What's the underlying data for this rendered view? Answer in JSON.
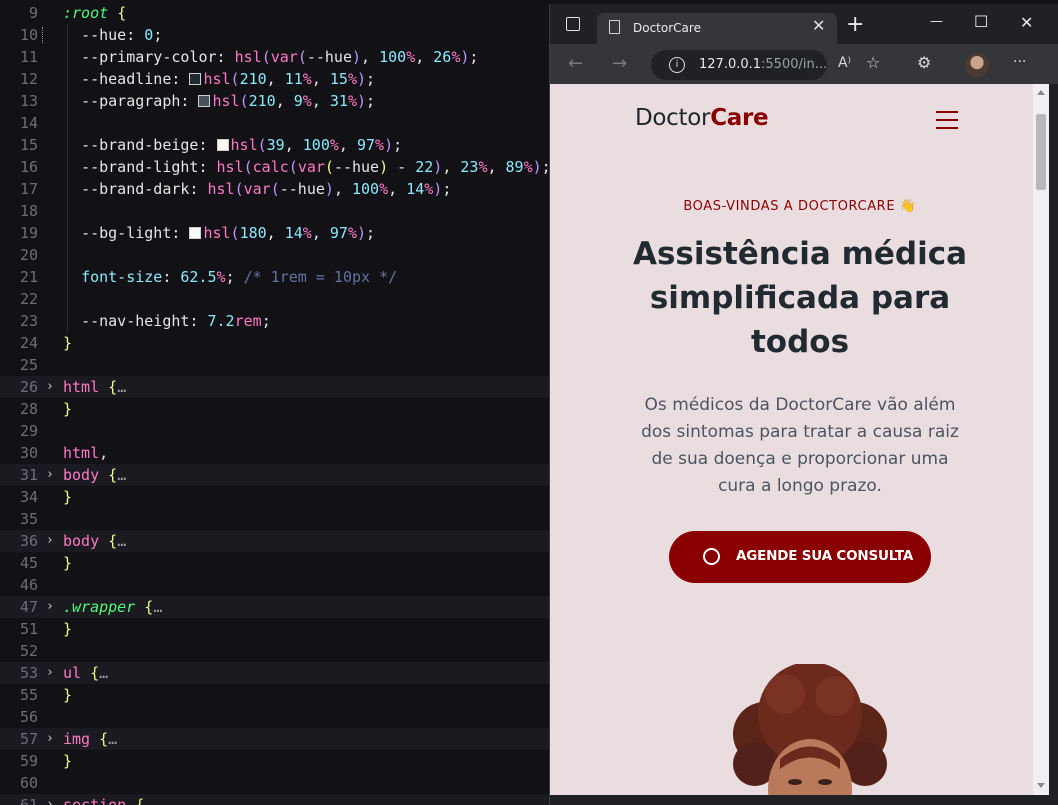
{
  "editor": {
    "lines": [
      {
        "n": "9"
      },
      {
        "n": "10"
      },
      {
        "n": "11"
      },
      {
        "n": "12"
      },
      {
        "n": "13"
      },
      {
        "n": "14"
      },
      {
        "n": "15"
      },
      {
        "n": "16"
      },
      {
        "n": "17"
      },
      {
        "n": "18"
      },
      {
        "n": "19"
      },
      {
        "n": "20"
      },
      {
        "n": "21"
      },
      {
        "n": "22"
      },
      {
        "n": "23"
      },
      {
        "n": "24"
      },
      {
        "n": "25"
      },
      {
        "n": "26"
      },
      {
        "n": "28"
      },
      {
        "n": "29"
      },
      {
        "n": "30"
      },
      {
        "n": "31"
      },
      {
        "n": "34"
      },
      {
        "n": "35"
      },
      {
        "n": "36"
      },
      {
        "n": "45"
      },
      {
        "n": "46"
      },
      {
        "n": "47"
      },
      {
        "n": "51"
      },
      {
        "n": "52"
      },
      {
        "n": "53"
      },
      {
        "n": "55"
      },
      {
        "n": "56"
      },
      {
        "n": "57"
      },
      {
        "n": "59"
      },
      {
        "n": "60"
      },
      {
        "n": "61"
      }
    ],
    "swatch_colors": {
      "headline": "#222a31",
      "paragraph": "#49525b",
      "brand_beige": "#fff8ef",
      "bg_light": "#f6fafa"
    }
  },
  "browser": {
    "tab_title": "DoctorCare",
    "url_host": "127.0.0.1",
    "url_rest": ":5500/in...",
    "controls": {
      "minimize": "—",
      "maximize": "☐",
      "close": "✕",
      "new_tab": "+",
      "tab_close": "✕"
    },
    "toolbar_icons": {
      "back": "←",
      "forward": "→",
      "read_aloud": "A⁾",
      "favorites": "☆",
      "extensions": "⚙",
      "menu": "···"
    }
  },
  "page": {
    "logo_prefix": "Doctor",
    "logo_suffix": "Care",
    "eyebrow": "BOAS-VINDAS A DOCTORCARE 👋",
    "headline": "Assistência médica simplificada para todos",
    "paragraph": "Os médicos da DoctorCare vão além dos sintomas para tratar a causa raiz de sua doença e proporcionar uma cura a longo prazo.",
    "cta_label": "AGENDE SUA CONSULTA",
    "brand_color": "#8a0000",
    "background_color": "#eadde0"
  }
}
